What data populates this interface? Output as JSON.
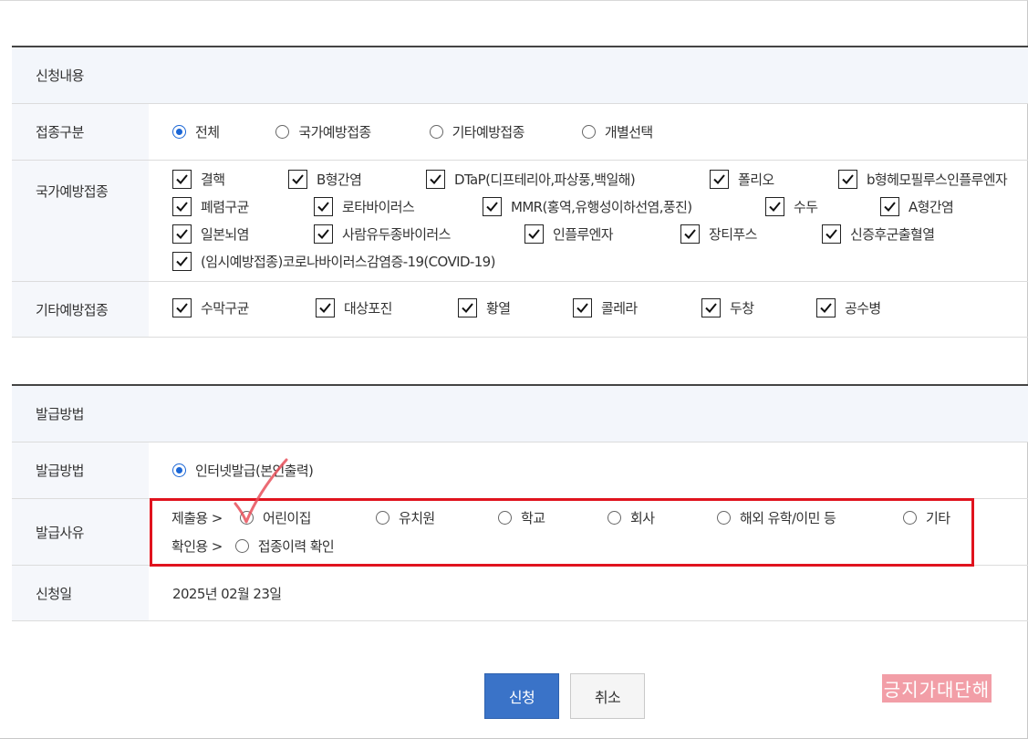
{
  "apply_section": {
    "title": "신청내용",
    "type_row": {
      "label": "접종구분",
      "options": [
        "전체",
        "국가예방접종",
        "기타예방접종",
        "개별선택"
      ],
      "selected": "전체"
    },
    "national_row": {
      "label": "국가예방접종",
      "items": [
        "결핵",
        "B형간염",
        "DTaP(디프테리아,파상풍,백일해)",
        "폴리오",
        "b형헤모필루스인플루엔자",
        "폐렴구균",
        "로타바이러스",
        "MMR(홍역,유행성이하선염,풍진)",
        "수두",
        "A형간염",
        "일본뇌염",
        "사람유두종바이러스",
        "인플루엔자",
        "장티푸스",
        "신증후군출혈열",
        "(임시예방접종)코로나바이러스감염증-19(COVID-19)"
      ],
      "checked": true
    },
    "other_row": {
      "label": "기타예방접종",
      "items": [
        "수막구균",
        "대상포진",
        "황열",
        "콜레라",
        "두창",
        "공수병"
      ],
      "checked": true
    }
  },
  "issue_section": {
    "title": "발급방법",
    "method_row": {
      "label": "발급방법",
      "option": "인터넷발급(본인출력)",
      "selected": true
    },
    "reason_row": {
      "label": "발급사유",
      "submit_prefix": "제출용 >",
      "submit_options": [
        "어린이집",
        "유치원",
        "학교",
        "회사",
        "해외 유학/이민 등",
        "기타"
      ],
      "confirm_prefix": "확인용 >",
      "confirm_options": [
        "접종이력 확인"
      ]
    },
    "date_row": {
      "label": "신청일",
      "value": "2025년 02월 23일"
    }
  },
  "buttons": {
    "apply": "신청",
    "cancel": "취소"
  },
  "watermark": "긍지가대단해",
  "colors": {
    "accent": "#3a73c8",
    "highlight": "#e0131e",
    "annotation": "#e8505b"
  }
}
